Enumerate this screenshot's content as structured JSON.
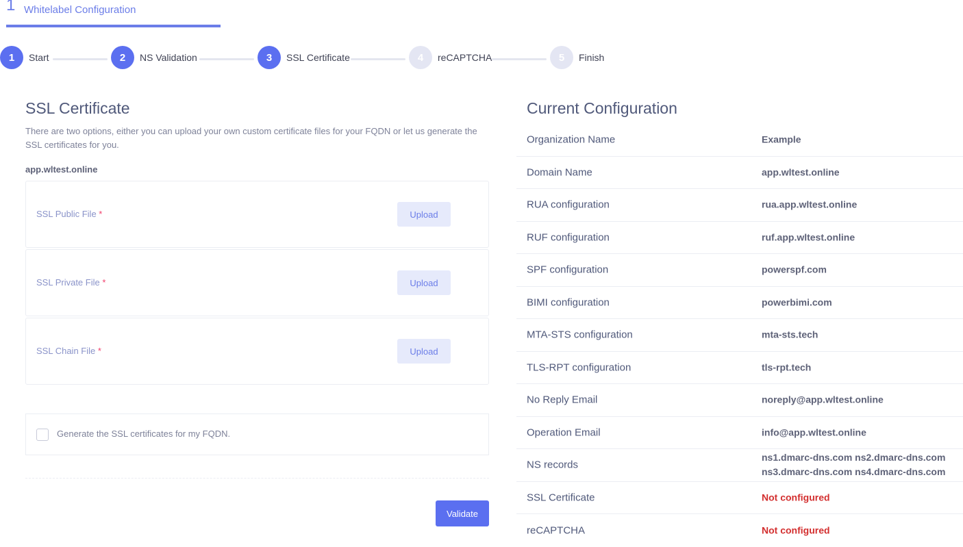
{
  "top_tab": {
    "number": "1",
    "label": "Whitelabel Configuration"
  },
  "steps": [
    {
      "number": "1",
      "label": "Start",
      "state": "active"
    },
    {
      "number": "2",
      "label": "NS Validation",
      "state": "active"
    },
    {
      "number": "3",
      "label": "SSL Certificate",
      "state": "active"
    },
    {
      "number": "4",
      "label": "reCAPTCHA",
      "state": "inactive"
    },
    {
      "number": "5",
      "label": "Finish",
      "state": "inactive"
    }
  ],
  "ssl": {
    "title": "SSL Certificate",
    "description": "There are two options, either you can upload your own custom certificate files for your FQDN or let us generate the SSL certificates for you.",
    "domain": "app.wltest.online",
    "files": [
      {
        "label": "SSL Public File",
        "required_mark": "*",
        "button": "Upload"
      },
      {
        "label": "SSL Private File",
        "required_mark": "*",
        "button": "Upload"
      },
      {
        "label": "SSL Chain File",
        "required_mark": "*",
        "button": "Upload"
      }
    ],
    "generate_label": "Generate the SSL certificates for my FQDN.",
    "validate_button": "Validate"
  },
  "config": {
    "title": "Current Configuration",
    "rows": [
      {
        "key": "Organization Name",
        "value": "Example"
      },
      {
        "key": "Domain Name",
        "value": "app.wltest.online"
      },
      {
        "key": "RUA configuration",
        "value": "rua.app.wltest.online"
      },
      {
        "key": "RUF configuration",
        "value": "ruf.app.wltest.online"
      },
      {
        "key": "SPF configuration",
        "value": "powerspf.com"
      },
      {
        "key": "BIMI configuration",
        "value": "powerbimi.com"
      },
      {
        "key": "MTA-STS configuration",
        "value": "mta-sts.tech"
      },
      {
        "key": "TLS-RPT configuration",
        "value": "tls-rpt.tech"
      },
      {
        "key": "No Reply Email",
        "value": "noreply@app.wltest.online"
      },
      {
        "key": "Operation Email",
        "value": "info@app.wltest.online"
      },
      {
        "key": "NS records",
        "value": "ns1.dmarc-dns.com ns2.dmarc-dns.com",
        "value2": "ns3.dmarc-dns.com ns4.dmarc-dns.com"
      },
      {
        "key": "SSL Certificate",
        "value": "Not configured"
      },
      {
        "key": "reCAPTCHA",
        "value": "Not configured"
      }
    ],
    "error_color": "#d32f2f"
  }
}
